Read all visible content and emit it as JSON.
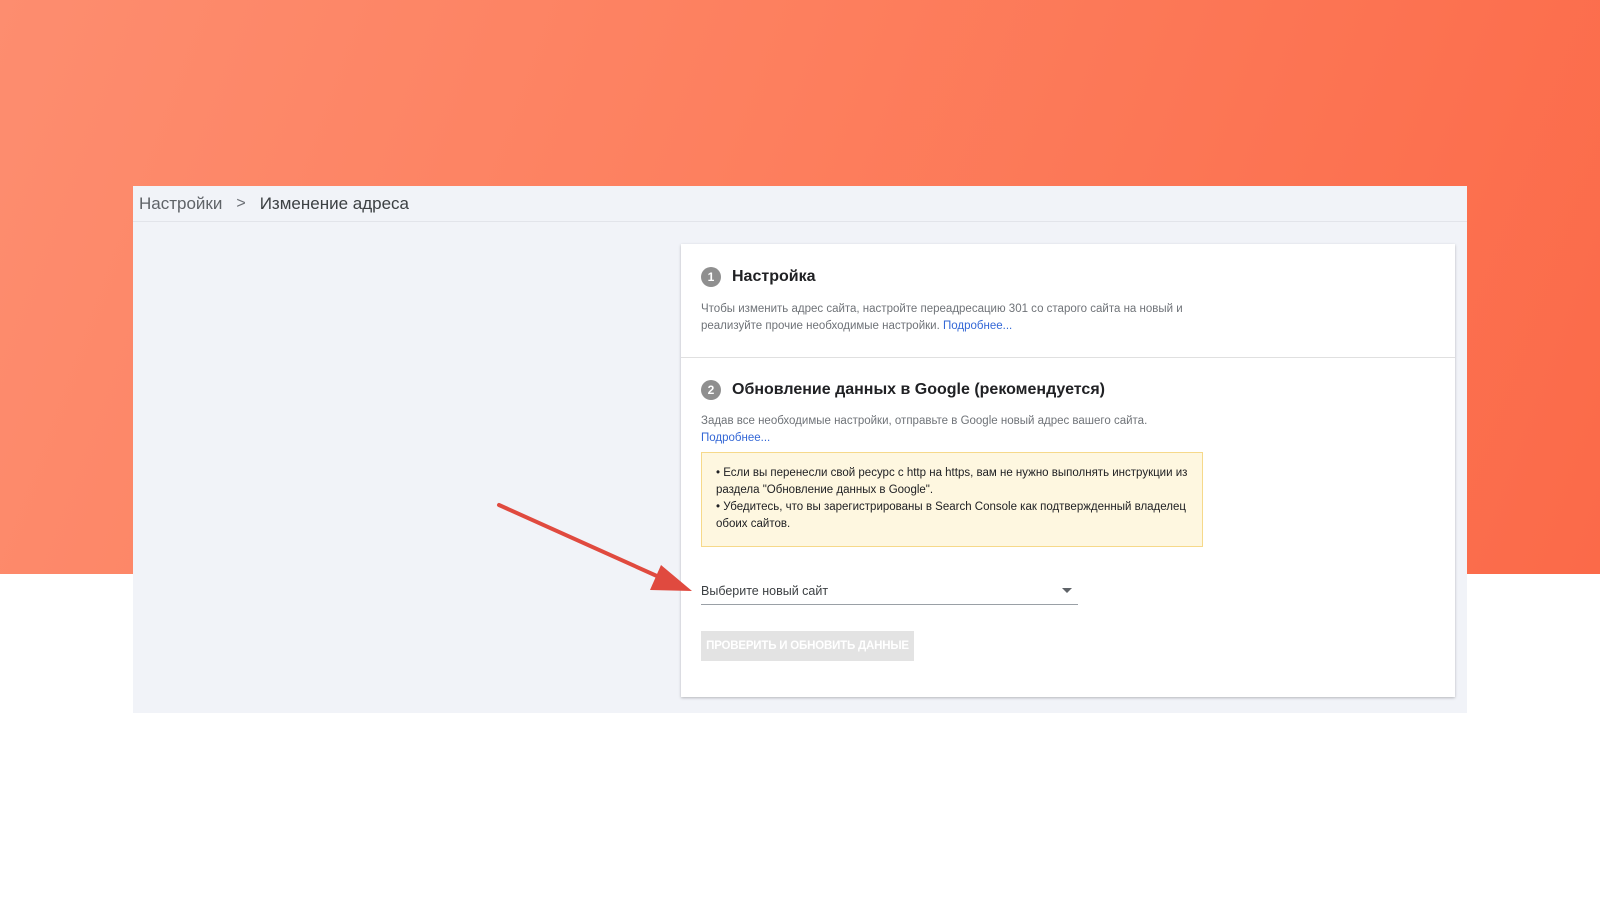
{
  "breadcrumb": {
    "root": "Настройки",
    "separator": ">",
    "current": "Изменение адреса"
  },
  "step1": {
    "number": "1",
    "title": "Настройка",
    "description": "Чтобы изменить адрес сайта, настройте переадресацию 301 со старого сайта на новый и реализуйте прочие необходимые настройки.",
    "link": "Подробнее..."
  },
  "step2": {
    "number": "2",
    "title": "Обновление данных в Google (рекомендуется)",
    "description": "Задав все необходимые настройки, отправьте в Google новый адрес вашего сайта.",
    "link": "Подробнее...",
    "notice": [
      "• Если вы перенесли свой ресурс с http на https, вам не нужно выполнять инструкции из раздела \"Обновление данных в Google\".",
      "• Убедитесь, что вы зарегистрированы в Search Console как подтвержденный владелец обоих сайтов."
    ],
    "select_label": "Выберите новый сайт",
    "button_label": "ПРОВЕРИТЬ И ОБНОВИТЬ ДАННЫЕ"
  },
  "colors": {
    "gradient_start": "#fd8d6f",
    "gradient_end": "#fb6a49",
    "arrow": "#e04a3f",
    "link": "#3367d6",
    "notice_bg": "#fef7e0"
  }
}
